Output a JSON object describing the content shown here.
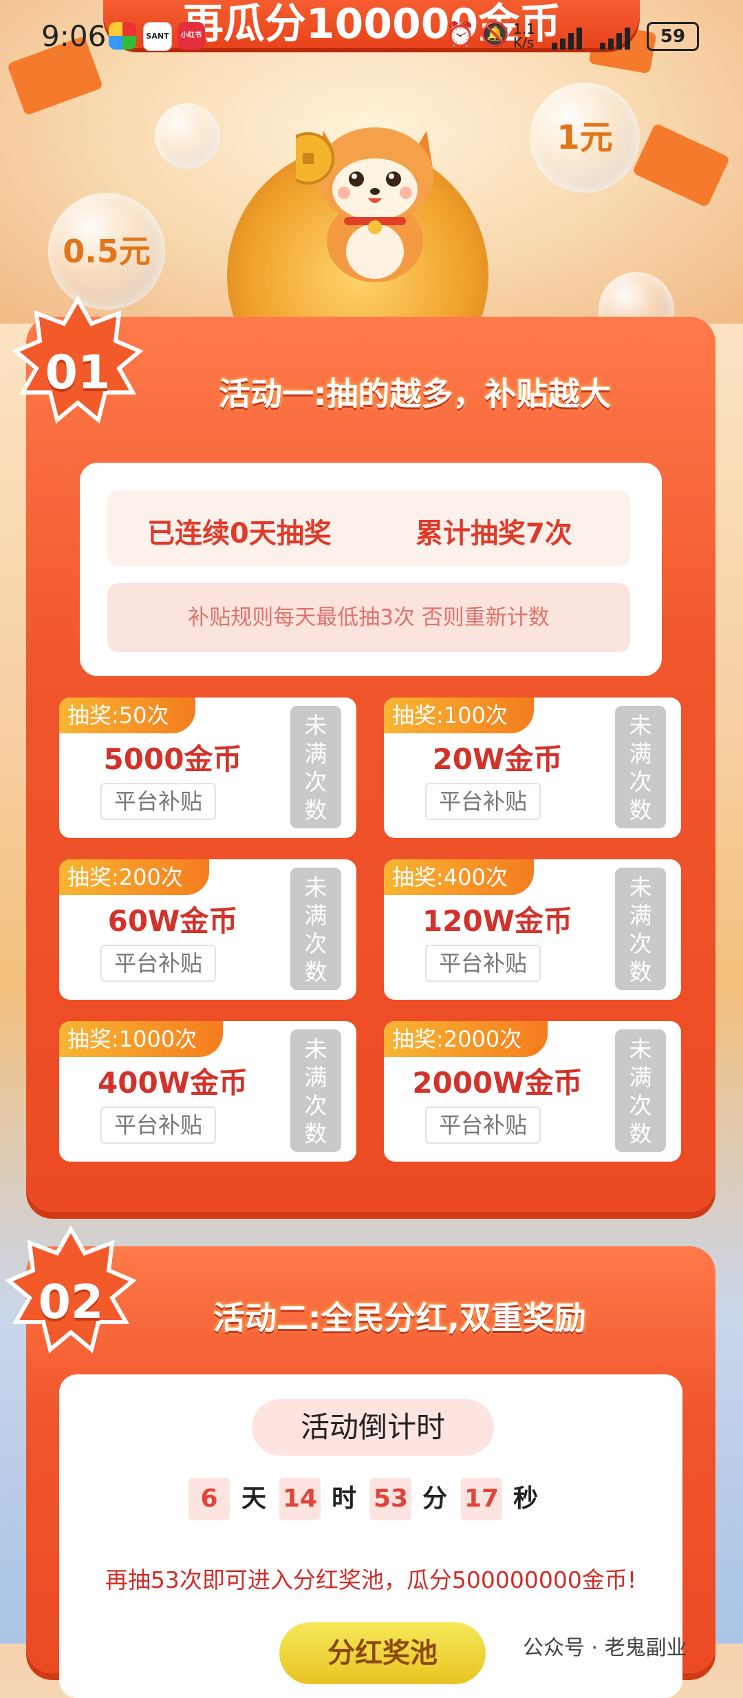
{
  "status_bar": {
    "time": "9:06",
    "app_icons": [
      "SANT",
      "小红书"
    ],
    "network_speed": "1.1 K/s",
    "battery": "59"
  },
  "hero": {
    "banner_text": "再瓜分100000金币",
    "bubble_left": "0.5元",
    "bubble_right": "1元"
  },
  "activity1": {
    "badge": "01",
    "title": "活动一:抽的越多，补贴越大",
    "stat_consecutive": "已连续0天抽奖",
    "stat_total": "累计抽奖7次",
    "rule": "补贴规则每天最低抽3次 否则重新计数",
    "tiles": [
      {
        "tag": "抽奖:50次",
        "amount": "5000金币",
        "sub": "平台补贴",
        "status": [
          "未",
          "满",
          "次",
          "数"
        ]
      },
      {
        "tag": "抽奖:100次",
        "amount": "20W金币",
        "sub": "平台补贴",
        "status": [
          "未",
          "满",
          "次",
          "数"
        ]
      },
      {
        "tag": "抽奖:200次",
        "amount": "60W金币",
        "sub": "平台补贴",
        "status": [
          "未",
          "满",
          "次",
          "数"
        ]
      },
      {
        "tag": "抽奖:400次",
        "amount": "120W金币",
        "sub": "平台补贴",
        "status": [
          "未",
          "满",
          "次",
          "数"
        ]
      },
      {
        "tag": "抽奖:1000次",
        "amount": "400W金币",
        "sub": "平台补贴",
        "status": [
          "未",
          "满",
          "次",
          "数"
        ]
      },
      {
        "tag": "抽奖:2000次",
        "amount": "2000W金币",
        "sub": "平台补贴",
        "status": [
          "未",
          "满",
          "次",
          "数"
        ]
      }
    ]
  },
  "activity2": {
    "badge": "02",
    "title": "活动二:全民分红,双重奖励",
    "countdown_title": "活动倒计时",
    "countdown": {
      "days": "6",
      "days_unit": "天",
      "hours": "14",
      "hours_unit": "时",
      "minutes": "53",
      "minutes_unit": "分",
      "seconds": "17",
      "seconds_unit": "秒"
    },
    "bonus_text": "再抽53次即可进入分红奖池，瓜分500000000金币!",
    "bonus_button": "分红奖池"
  },
  "watermark": "公众号 · 老鬼副业",
  "colors": {
    "card": "#f0552b",
    "accent_red": "#d2322a",
    "tag_gradient": "#f8b532",
    "disabled_grey": "#c9c9c9"
  }
}
